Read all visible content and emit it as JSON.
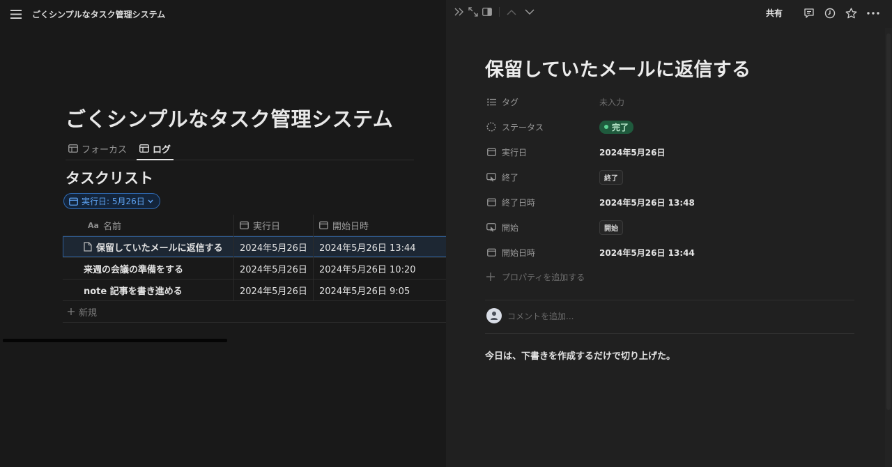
{
  "left": {
    "workspace_title": "ごくシンプルなタスク管理システム",
    "page_title": "ごくシンプルなタスク管理システム",
    "views": [
      {
        "label": "フォーカス",
        "active": false
      },
      {
        "label": "ログ",
        "active": true
      }
    ],
    "list_title": "タスクリスト",
    "filter": {
      "label": "実行日: 5月26日"
    },
    "table": {
      "columns": {
        "name_prefix": "Aa",
        "name": "名前",
        "date": "実行日",
        "start": "開始日時"
      },
      "rows": [
        {
          "name": "保留していたメールに返信する",
          "date": "2024年5月26日",
          "start": "2024年5月26日 13:44"
        },
        {
          "name": "来週の会議の準備をする",
          "date": "2024年5月26日",
          "start": "2024年5月26日 10:20"
        },
        {
          "name": "note 記事を書き進める",
          "date": "2024年5月26日",
          "start": "2024年5月26日 9:05"
        }
      ],
      "new_label": "新規"
    }
  },
  "right": {
    "topbar": {
      "share_label": "共有"
    },
    "title": "保留していたメールに返信する",
    "properties": {
      "tag": {
        "label": "タグ",
        "value": "未入力"
      },
      "status": {
        "label": "ステータス",
        "value": "完了"
      },
      "date": {
        "label": "実行日",
        "value": "2024年5月26日"
      },
      "end": {
        "label": "終了",
        "value": "終了"
      },
      "end_time": {
        "label": "終了日時",
        "value": "2024年5月26日 13:48"
      },
      "start": {
        "label": "開始",
        "value": "開始"
      },
      "start_time": {
        "label": "開始日時",
        "value": "2024年5月26日 13:44"
      }
    },
    "add_property_label": "プロパティを追加する",
    "comment_placeholder": "コメントを追加...",
    "body_text": "今日は、下書きを作成するだけで切り上げた。"
  },
  "colors": {
    "background": "#191919",
    "panel": "#202020",
    "accent_blue": "#5ea3f3",
    "status_green": "#1f5a3d"
  }
}
